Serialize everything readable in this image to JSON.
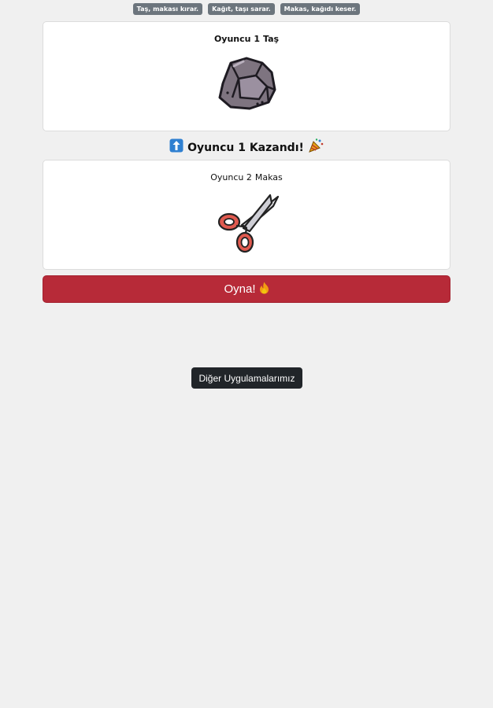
{
  "rules": [
    "Taş, makası kırar.",
    "Kağıt, taşı sarar.",
    "Makas, kağıdı keser."
  ],
  "player1": {
    "label": "Oyuncu 1",
    "choice": "Taş",
    "choice_icon": "rock-icon"
  },
  "result": {
    "text": "Oyuncu 1 Kazandı!",
    "lead_icon": "up-arrow-icon",
    "trail_icon": "party-popper-icon"
  },
  "player2": {
    "label": "Oyuncu 2",
    "choice": "Makas",
    "choice_icon": "scissors-icon"
  },
  "play_button": {
    "label": "Oyna!",
    "icon": "fire-icon"
  },
  "other_apps_button": {
    "label": "Diğer Uygulamalarımız"
  },
  "colors": {
    "background": "#f0f0f0",
    "badge": "#6c757d",
    "play_button": "#b72a38",
    "other_apps_button": "#212529"
  }
}
